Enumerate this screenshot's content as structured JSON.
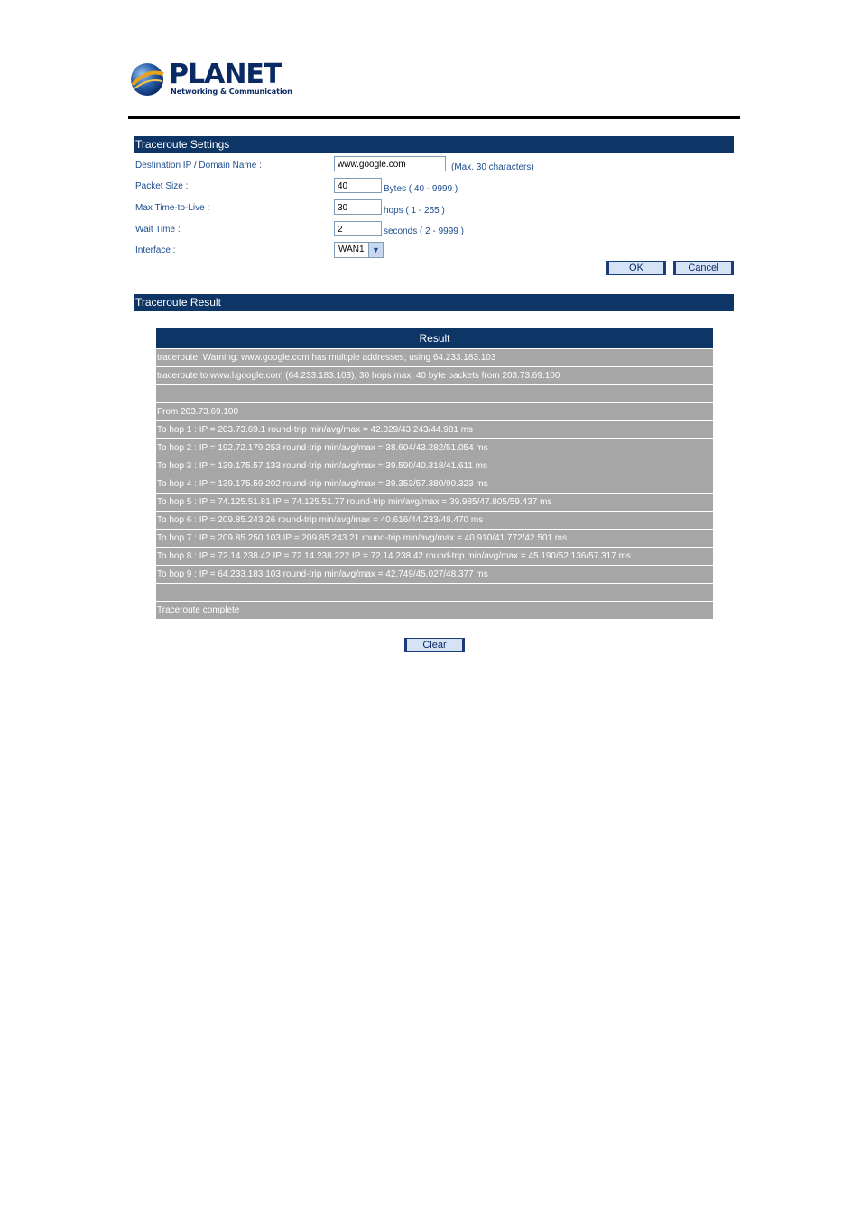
{
  "brand": {
    "name": "PLANET",
    "tagline": "Networking & Communication"
  },
  "settings": {
    "title": "Traceroute Settings",
    "destination_label": "Destination IP / Domain Name :",
    "destination_value": "www.google.com",
    "destination_hint": "(Max. 30 characters)",
    "packet_size_label": "Packet Size :",
    "packet_size_value": "40",
    "packet_size_hint": "Bytes  ( 40 - 9999 )",
    "ttl_label": "Max Time-to-Live :",
    "ttl_value": "30",
    "ttl_hint": "hops  ( 1 - 255 )",
    "wait_label": "Wait Time :",
    "wait_value": "2",
    "wait_hint": "seconds  ( 2 - 9999 )",
    "interface_label": "Interface :",
    "interface_value": "WAN1",
    "ok_label": "OK",
    "cancel_label": "Cancel"
  },
  "result": {
    "title": "Traceroute Result",
    "header": "Result",
    "rows": [
      "traceroute: Warning: www.google.com has multiple addresses; using 64.233.183.103",
      "traceroute to www.l.google.com (64.233.183.103), 30 hops max, 40 byte packets from 203.73.69.100",
      "",
      "From 203.73.69.100",
      "To hop 1 : IP = 203.73.69.1  round-trip min/avg/max = 42.029/43.243/44.981 ms",
      "To hop 2 : IP = 192.72.179.253  round-trip min/avg/max = 38.604/43.282/51.054 ms",
      "To hop 3 : IP = 139.175.57.133  round-trip min/avg/max = 39.590/40.318/41.611 ms",
      "To hop 4 : IP = 139.175.59.202  round-trip min/avg/max = 39.353/57.380/90.323 ms",
      "To hop 5 : IP = 74.125.51.81 IP = 74.125.51.77  round-trip min/avg/max = 39.985/47.805/59.437 ms",
      "To hop 6 : IP = 209.85.243.26  round-trip min/avg/max = 40.616/44.233/48.470 ms",
      "To hop 7 : IP = 209.85.250.103 IP = 209.85.243.21  round-trip min/avg/max = 40.910/41.772/42.501 ms",
      "To hop 8 : IP = 72.14.238.42 IP = 72.14.238.222 IP = 72.14.238.42  round-trip min/avg/max = 45.190/52.136/57.317 ms",
      "To hop 9 : IP = 64.233.183.103  round-trip min/avg/max = 42.749/45.027/48.377 ms",
      "",
      "Traceroute complete"
    ],
    "clear_label": "Clear"
  },
  "colors": {
    "header_bar": "#0d3566",
    "row_bg": "#a6a6a6",
    "label_text": "#1d4d8e"
  }
}
